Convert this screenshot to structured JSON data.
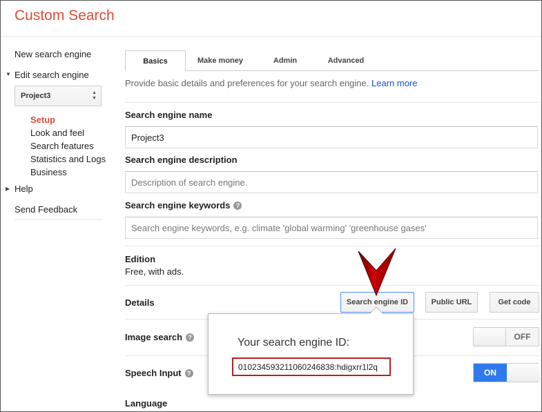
{
  "app": {
    "title": "Custom Search"
  },
  "sidebar": {
    "new_engine": "New search engine",
    "edit_engine": "Edit search engine",
    "project_select": "Project3",
    "sub_items": [
      "Setup",
      "Look and feel",
      "Search features",
      "Statistics and Logs",
      "Business"
    ],
    "help": "Help",
    "feedback": "Send Feedback"
  },
  "tabs": [
    "Basics",
    "Make money",
    "Admin",
    "Advanced"
  ],
  "intro": {
    "text": "Provide basic details and preferences for your search engine.",
    "link": "Learn more"
  },
  "form": {
    "name_label": "Search engine name",
    "name_value": "Project3",
    "description_label": "Search engine description",
    "description_placeholder": "Description of search engine.",
    "keywords_label": "Search engine keywords",
    "keywords_placeholder": "Search engine keywords, e.g. climate 'global warming' 'greenhouse gases'",
    "edition_label": "Edition",
    "edition_value": "Free, with ads.",
    "details_label": "Details",
    "image_search_label": "Image search",
    "speech_input_label": "Speech Input",
    "language_label": "Language"
  },
  "buttons": {
    "engine_id": "Search engine ID",
    "public_url": "Public URL",
    "get_code": "Get code"
  },
  "toggles": {
    "image_search": "OFF",
    "speech_input": "ON"
  },
  "popup": {
    "title": "Your search engine ID:",
    "engine_id": "010234593211060246838:hdigxrr1l2q"
  },
  "colors": {
    "brand_red": "#dd4b39",
    "link_blue": "#15c",
    "toggle_blue": "#3079ed",
    "highlight_red": "#b22222"
  },
  "icons": {
    "help": "help-circle-icon",
    "expand": "triangle-down-icon",
    "collapse": "triangle-right-icon",
    "select": "sort-arrows-icon",
    "pointer": "red-arrow-pointer-icon"
  }
}
